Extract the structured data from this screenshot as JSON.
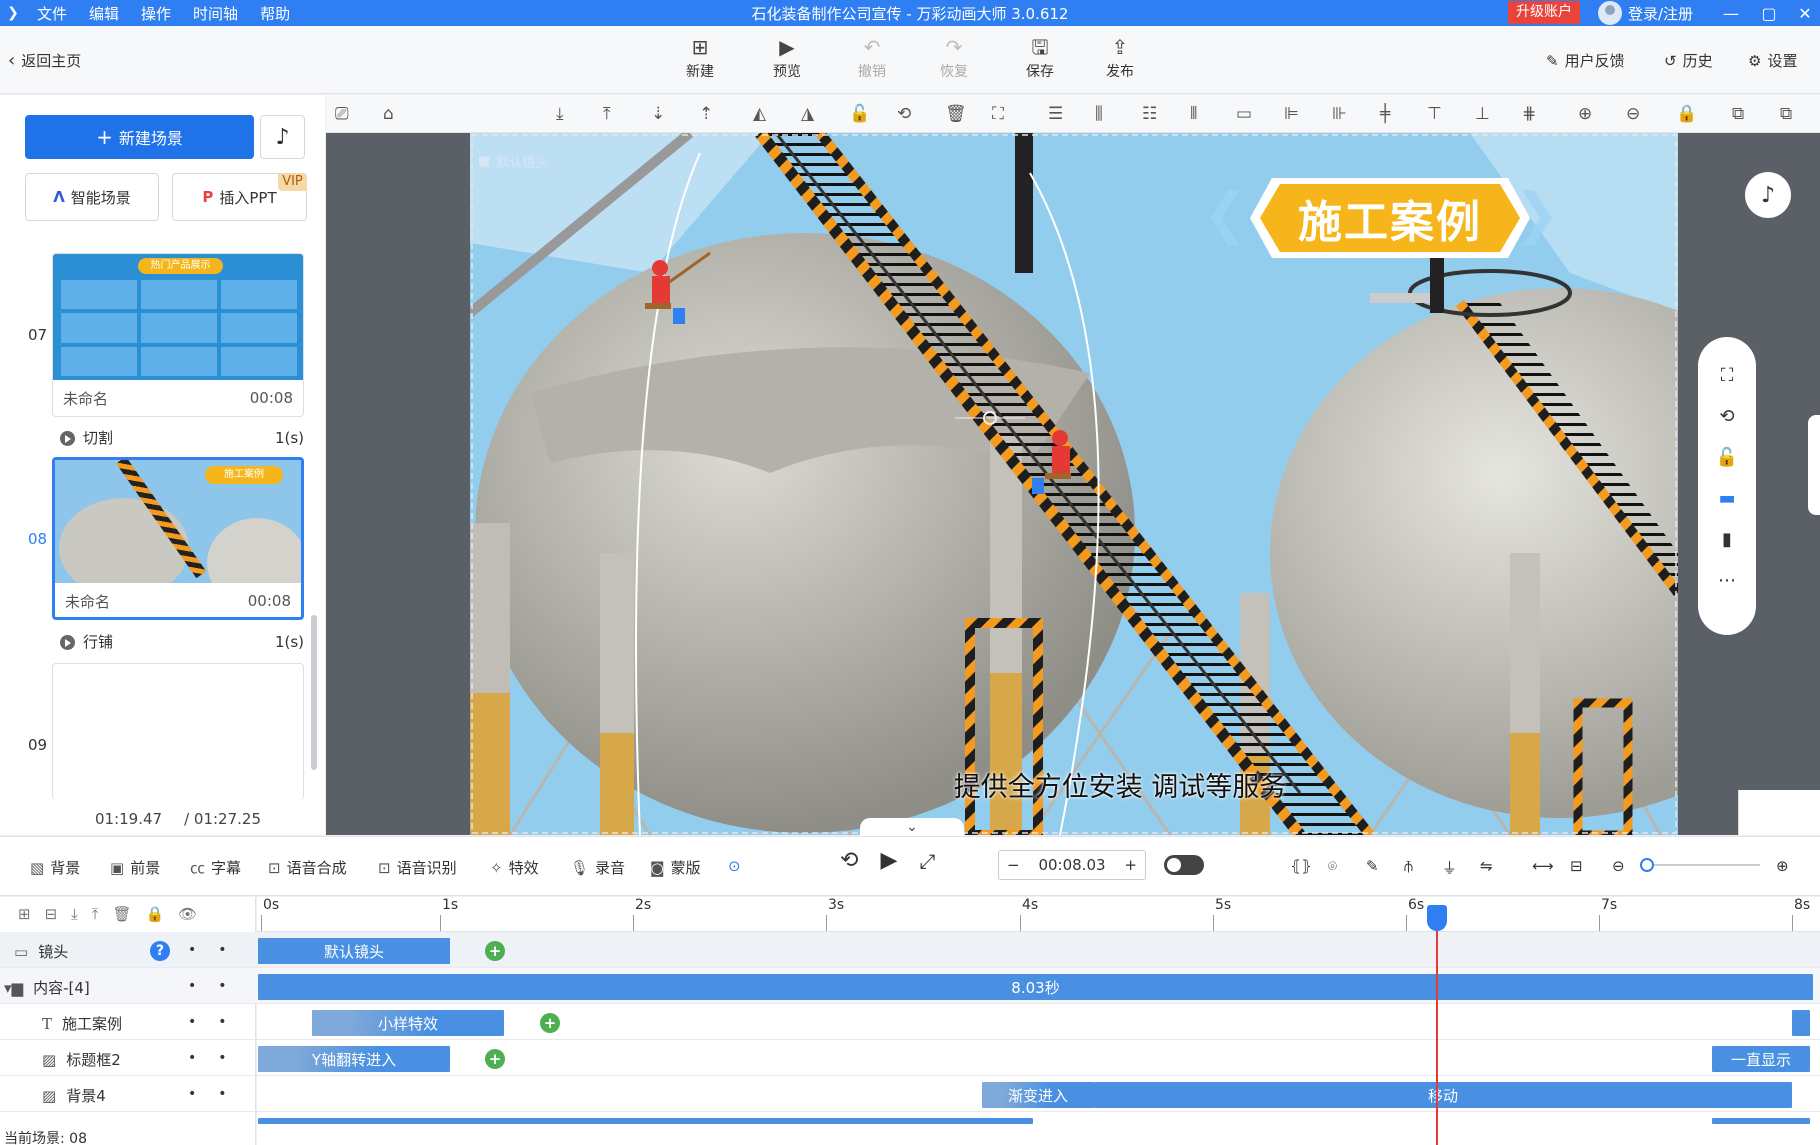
{
  "titlebar": {
    "menu": [
      "文件",
      "编辑",
      "操作",
      "时间轴",
      "帮助"
    ],
    "title": "石化装备制作公司宣传 - 万彩动画大师 3.0.612",
    "upgrade": "升级账户",
    "login": "登录/注册"
  },
  "toolbar": {
    "back": "返回主页",
    "new": "新建",
    "preview": "预览",
    "undo": "撤销",
    "redo": "恢复",
    "save": "保存",
    "publish": "发布",
    "feedback": "用户反馈",
    "history": "历史",
    "settings": "设置"
  },
  "leftpanel": {
    "new_scene": "新建场景",
    "smart_scene": "智能场景",
    "insert_ppt": "插入PPT",
    "vip": "VIP",
    "scenes": [
      {
        "num": "07",
        "name": "未命名",
        "duration": "00:08",
        "thumb_badge": "热门产品展示"
      },
      {
        "num": "08",
        "name": "未命名",
        "duration": "00:08",
        "thumb_badge": "施工案例"
      },
      {
        "num": "09"
      }
    ],
    "transitions": [
      {
        "name": "切割",
        "time": "1(s)"
      },
      {
        "name": "行铺",
        "time": "1(s)"
      }
    ],
    "current_time": "01:19.47",
    "total_time": "/ 01:27.25"
  },
  "canvas": {
    "camera_label": "默认镜头",
    "scene_title": "施工案例",
    "subtitle": "提供全方位安装 调试等服务"
  },
  "bottombar": {
    "items": [
      "背景",
      "前景",
      "字幕",
      "语音合成",
      "语音识别",
      "特效",
      "录音",
      "蒙版"
    ],
    "timecode": "00:08.03"
  },
  "timeline": {
    "ruler": [
      "0s",
      "1s",
      "2s",
      "3s",
      "4s",
      "5s",
      "6s",
      "7s",
      "8s"
    ],
    "rows": [
      {
        "label": "镜头"
      },
      {
        "label": "内容-[4]"
      },
      {
        "label": "施工案例"
      },
      {
        "label": "标题框2"
      },
      {
        "label": "背景4"
      }
    ],
    "clips": {
      "camera": "默认镜头",
      "content": "8.03秒",
      "text_effect": "小样特效",
      "title_effect": "Y轴翻转进入",
      "title_end": "一直显示",
      "bg_in": "渐变进入",
      "bg_move": "移动"
    },
    "current_scene": "当前场景: 08"
  },
  "colors": {
    "accent": "#2f7ff2",
    "title_bg": "#f6b51a",
    "clip": "#4a90e2",
    "keyframe": "#4caf50",
    "playhead": "#e53935"
  }
}
